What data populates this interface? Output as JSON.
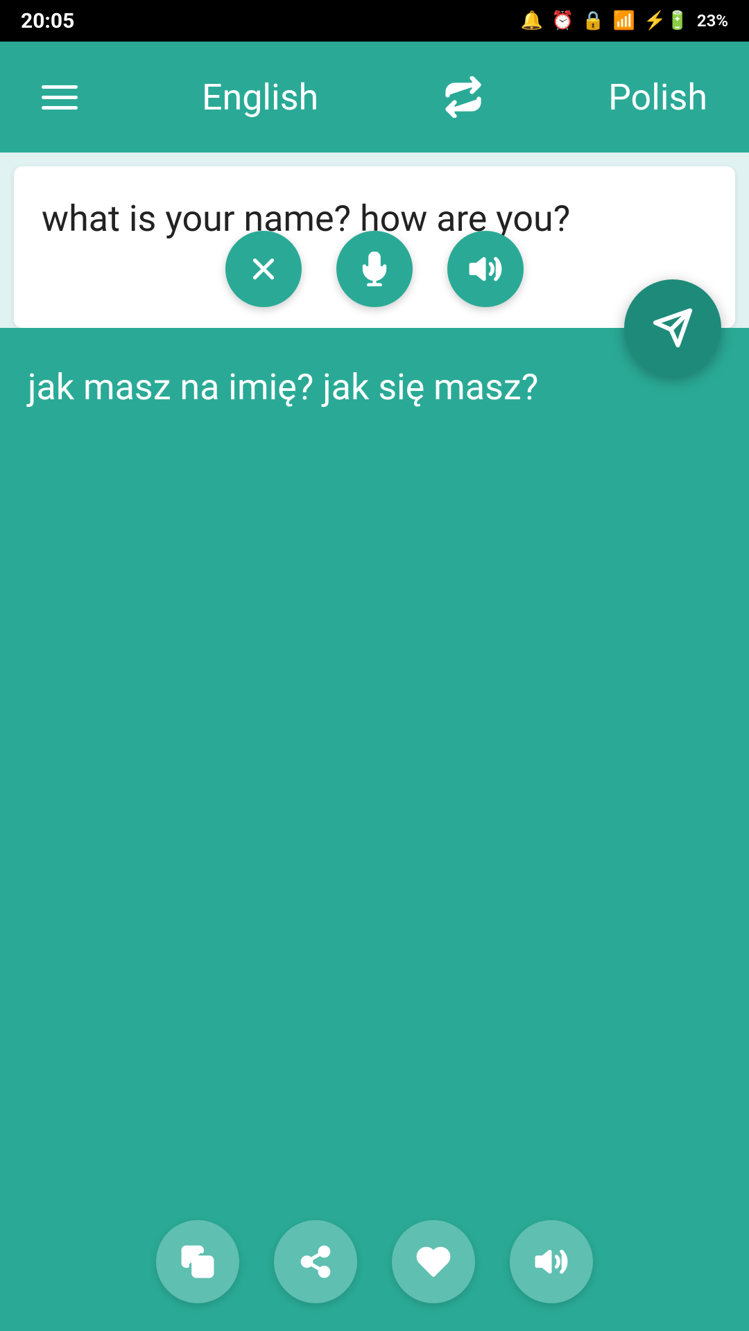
{
  "status": {
    "time": "20:05",
    "battery": "23%"
  },
  "toolbar": {
    "menu_label": "menu",
    "source_lang": "English",
    "swap_label": "swap languages",
    "target_lang": "Polish"
  },
  "source": {
    "text": "what is your name? how are you?",
    "clear_label": "clear",
    "mic_label": "microphone",
    "speaker_label": "speak source"
  },
  "fab": {
    "label": "translate"
  },
  "translation": {
    "text": "jak masz na imię? jak się masz?",
    "copy_label": "copy",
    "share_label": "share",
    "favorite_label": "favorite",
    "speaker_label": "speak translation"
  }
}
